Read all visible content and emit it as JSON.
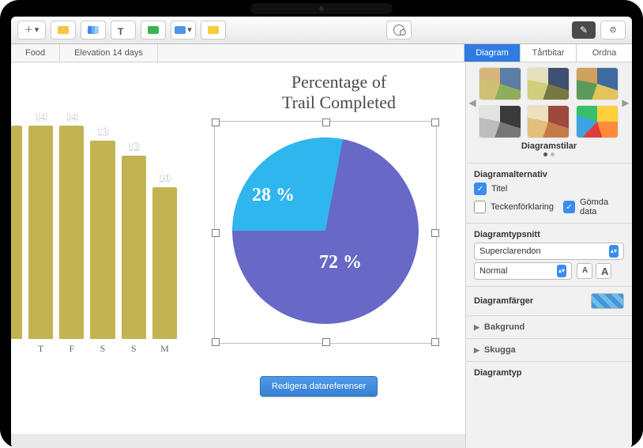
{
  "tabs": {
    "food": "Food",
    "elev": "Elevation 14 days"
  },
  "fmt": {
    "diagram": "Diagram",
    "wedges": "Tårtbitar",
    "arrange": "Ordna"
  },
  "canvas": {
    "chart_title_l1": "Percentage of",
    "chart_title_l2": "Trail Completed",
    "edit_button": "Redigera datareferenser",
    "pie_label_minor": "28 %",
    "pie_label_major": "72 %"
  },
  "bars": {
    "values": [
      "14",
      "14",
      "13",
      "12",
      "10"
    ],
    "x": [
      "T",
      "F",
      "S",
      "S",
      "M"
    ]
  },
  "inspector": {
    "styles_label": "Diagramstilar",
    "options_h": "Diagramalternativ",
    "title_chk": "Titel",
    "legend_chk": "Teckenförklaring",
    "hidden_chk": "Gömda data",
    "font_h": "Diagramtypsnitt",
    "font_family": "Superclarendon",
    "font_style": "Normal",
    "smallA": "A",
    "bigA": "A",
    "colors_h": "Diagramfärger",
    "bg": "Bakgrund",
    "shadow": "Skugga",
    "type_h": "Diagramtyp"
  },
  "chart_data": [
    {
      "type": "bar",
      "categories": [
        "T",
        "F",
        "S",
        "S",
        "M"
      ],
      "values": [
        14,
        14,
        13,
        12,
        10
      ],
      "note": "partial view — leftmost bars clipped"
    },
    {
      "type": "pie",
      "title": "Percentage of Trail Completed",
      "series": [
        {
          "name": "",
          "values": [
            28,
            72
          ],
          "labels": [
            "28 %",
            "72 %"
          ]
        }
      ]
    }
  ]
}
